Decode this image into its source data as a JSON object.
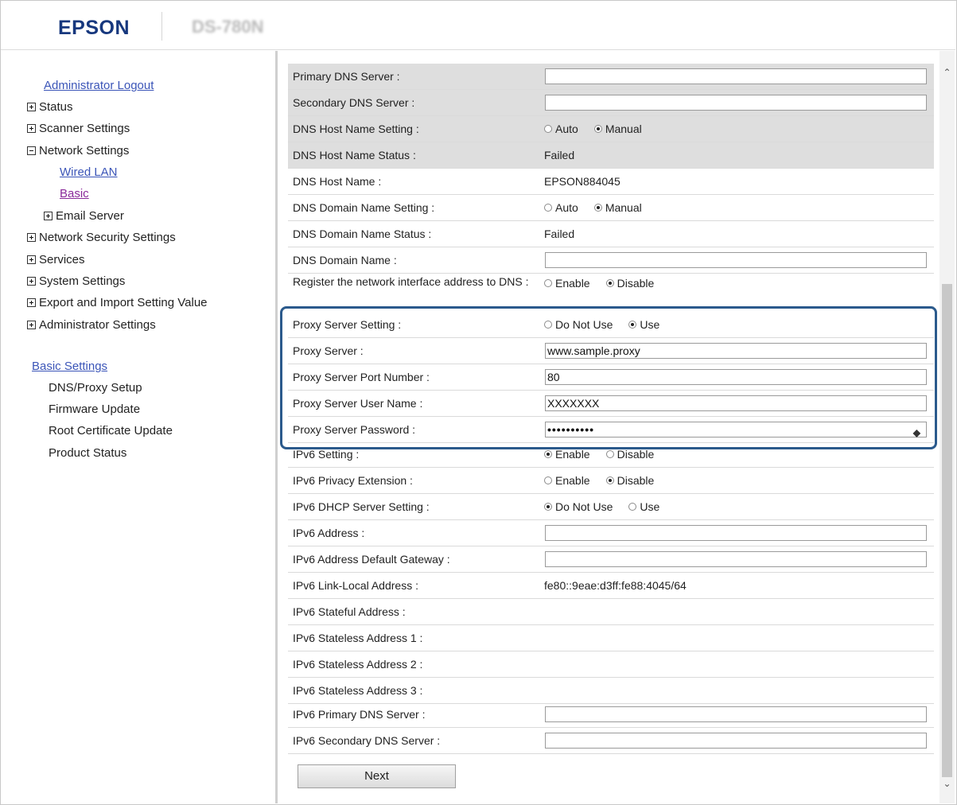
{
  "header": {
    "brand": "EPSON",
    "model": "DS-780N"
  },
  "sidebar": {
    "logout": "Administrator Logout",
    "items": [
      {
        "label": "Status",
        "state": "collapsed"
      },
      {
        "label": "Scanner Settings",
        "state": "collapsed"
      },
      {
        "label": "Network Settings",
        "state": "expanded"
      },
      {
        "label": "Wired LAN"
      },
      {
        "label": "Basic"
      },
      {
        "label": "Email Server",
        "state": "collapsed"
      },
      {
        "label": "Network Security Settings",
        "state": "collapsed"
      },
      {
        "label": "Services",
        "state": "collapsed"
      },
      {
        "label": "System Settings",
        "state": "collapsed"
      },
      {
        "label": "Export and Import Setting Value",
        "state": "collapsed"
      },
      {
        "label": "Administrator Settings",
        "state": "collapsed"
      }
    ],
    "basic_settings": {
      "title": "Basic Settings",
      "links": [
        "DNS/Proxy Setup",
        "Firmware Update",
        "Root Certificate Update",
        "Product Status"
      ]
    }
  },
  "form": {
    "rows": [
      {
        "label": "Primary DNS Server :",
        "type": "input",
        "value": ""
      },
      {
        "label": "Secondary DNS Server :",
        "type": "input",
        "value": ""
      },
      {
        "label": "DNS Host Name Setting :",
        "type": "radio",
        "options": [
          "Auto",
          "Manual"
        ],
        "selected": "Manual"
      },
      {
        "label": "DNS Host Name Status :",
        "type": "text",
        "value": "Failed"
      },
      {
        "label": "DNS Host Name :",
        "type": "text",
        "value": "EPSON884045"
      },
      {
        "label": "DNS Domain Name Setting :",
        "type": "radio",
        "options": [
          "Auto",
          "Manual"
        ],
        "selected": "Manual"
      },
      {
        "label": "DNS Domain Name Status :",
        "type": "text",
        "value": "Failed"
      },
      {
        "label": "DNS Domain Name :",
        "type": "input",
        "value": ""
      },
      {
        "label": "Register the network interface address to DNS :",
        "type": "radio",
        "options": [
          "Enable",
          "Disable"
        ],
        "selected": "Disable"
      },
      {
        "label": "Proxy Server Setting :",
        "type": "radio",
        "options": [
          "Do Not Use",
          "Use"
        ],
        "selected": "Use"
      },
      {
        "label": "Proxy Server :",
        "type": "input",
        "value": "www.sample.proxy"
      },
      {
        "label": "Proxy Server Port Number :",
        "type": "input",
        "value": "80"
      },
      {
        "label": "Proxy Server User Name :",
        "type": "input",
        "value": "XXXXXXX"
      },
      {
        "label": "Proxy Server Password :",
        "type": "password",
        "value": "••••••••••"
      },
      {
        "label": "IPv6 Setting :",
        "type": "radio",
        "options": [
          "Enable",
          "Disable"
        ],
        "selected": "Enable"
      },
      {
        "label": "IPv6 Privacy Extension :",
        "type": "radio",
        "options": [
          "Enable",
          "Disable"
        ],
        "selected": "Disable"
      },
      {
        "label": "IPv6 DHCP Server Setting :",
        "type": "radio",
        "options": [
          "Do Not Use",
          "Use"
        ],
        "selected": "Do Not Use"
      },
      {
        "label": "IPv6 Address :",
        "type": "input",
        "value": ""
      },
      {
        "label": "IPv6 Address Default Gateway :",
        "type": "input",
        "value": ""
      },
      {
        "label": "IPv6 Link-Local Address :",
        "type": "text",
        "value": "fe80::9eae:d3ff:fe88:4045/64"
      },
      {
        "label": "IPv6 Stateful Address :",
        "type": "text",
        "value": ""
      },
      {
        "label": "IPv6 Stateless Address 1 :",
        "type": "text",
        "value": ""
      },
      {
        "label": "IPv6 Stateless Address 2 :",
        "type": "text",
        "value": ""
      },
      {
        "label": "IPv6 Stateless Address 3 :",
        "type": "text",
        "value": ""
      },
      {
        "label": "IPv6 Primary DNS Server :",
        "type": "input",
        "value": ""
      },
      {
        "label": "IPv6 Secondary DNS Server :",
        "type": "input",
        "value": ""
      }
    ],
    "next_label": "Next"
  },
  "colors": {
    "brand": "#17387e",
    "link": "#3b55b8",
    "visited": "#8a2a9a",
    "highlight": "#2b5a8c"
  }
}
